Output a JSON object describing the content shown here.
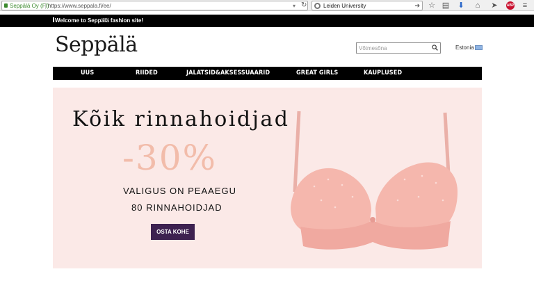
{
  "browser": {
    "site_identity": "Seppälä Oy (FI)",
    "url": "https://www.seppala.fi/ee/",
    "search_query": "Leiden University",
    "icons": [
      "lock-icon",
      "reload-icon",
      "search-engine-icon",
      "go-icon",
      "star-icon",
      "reading-list-icon",
      "download-icon",
      "home-icon",
      "send-icon",
      "adblock-icon",
      "menu-icon"
    ],
    "adblock_label": "ABP"
  },
  "announcement": {
    "text": "Welcome to Seppälä fashion site!"
  },
  "header": {
    "logo": "Seppälä",
    "search_placeholder": "Võtmesõna",
    "country": "Estonia"
  },
  "nav": {
    "items": [
      {
        "label": "UUS"
      },
      {
        "label": "RIIDED"
      },
      {
        "label": "JALATSID&AKSESSUAARID"
      },
      {
        "label": "GREAT GIRLS"
      },
      {
        "label": "KAUPLUSED"
      }
    ]
  },
  "hero": {
    "headline": "Kõik rinnahoidjad",
    "discount": "-30%",
    "subline1": "VALIGUS ON PEAAEGU",
    "subline2": "80 RINNAHOIDJAD",
    "cta": "OSTA KOHE",
    "accent_color": "#f2bcaa",
    "cta_color": "#3d2150",
    "background_color": "#fbe9e7"
  }
}
